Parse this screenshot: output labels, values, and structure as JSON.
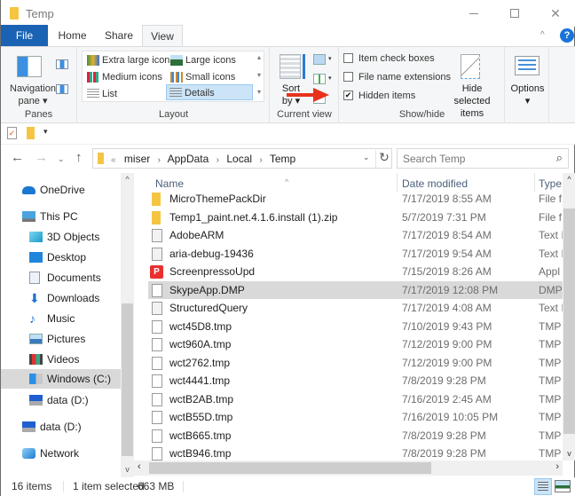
{
  "window": {
    "title": "Temp",
    "controls": {
      "minimize": "—",
      "maximize": "☐",
      "close": "✕"
    }
  },
  "ribbon_tabs": [
    {
      "label": "File",
      "active": false
    },
    {
      "label": "Home",
      "active": false
    },
    {
      "label": "Share",
      "active": false
    },
    {
      "label": "View",
      "active": true
    }
  ],
  "ribbon": {
    "collapse_glyph": "^",
    "help_glyph": "?",
    "panes": {
      "group_label": "Panes",
      "navigation_pane_label": "Navigation pane",
      "dropdown_glyph": "▾"
    },
    "layout": {
      "group_label": "Layout",
      "items": [
        {
          "label": "Extra large icons",
          "selected": false
        },
        {
          "label": "Large icons",
          "selected": false
        },
        {
          "label": "Medium icons",
          "selected": false
        },
        {
          "label": "Small icons",
          "selected": false
        },
        {
          "label": "List",
          "selected": false
        },
        {
          "label": "Details",
          "selected": true
        }
      ],
      "scroll_up": "▴",
      "scroll_down": "▾",
      "more": "▾"
    },
    "current_view": {
      "group_label": "Current view",
      "sort_by_label": "Sort by",
      "dropdown_glyph": "▾"
    },
    "show_hide": {
      "group_label": "Show/hide",
      "checkboxes": [
        {
          "label": "Item check boxes",
          "checked": false
        },
        {
          "label": "File name extensions",
          "checked": false
        },
        {
          "label": "Hidden items",
          "checked": true
        }
      ],
      "hide_selected_label": "Hide selected items"
    },
    "options": {
      "label": "Options",
      "dropdown_glyph": "▾"
    }
  },
  "annotation": {
    "arrow_color": "#e8321c",
    "points_to": "Hidden items"
  },
  "quick_access": {
    "more_glyph": "▾"
  },
  "address_bar": {
    "back": "←",
    "forward": "→",
    "recent": "⌄",
    "up": "↑",
    "overflow": "«",
    "breadcrumbs": [
      "miser",
      "AppData",
      "Local",
      "Temp"
    ],
    "separator": "›",
    "dropdown": "⌄",
    "refresh": "↻"
  },
  "search": {
    "placeholder": "Search Temp",
    "icon": "⌕"
  },
  "nav_pane": {
    "items": [
      {
        "label": "OneDrive",
        "icon": "cloud-icon",
        "level": 0,
        "selected": false
      },
      {
        "label": "This PC",
        "icon": "computer-icon",
        "level": 0,
        "selected": false
      },
      {
        "label": "3D Objects",
        "icon": "cube-icon",
        "level": 1,
        "selected": false
      },
      {
        "label": "Desktop",
        "icon": "desktop-icon",
        "level": 1,
        "selected": false
      },
      {
        "label": "Documents",
        "icon": "document-icon",
        "level": 1,
        "selected": false
      },
      {
        "label": "Downloads",
        "icon": "download-icon",
        "level": 1,
        "selected": false
      },
      {
        "label": "Music",
        "icon": "music-icon",
        "level": 1,
        "selected": false
      },
      {
        "label": "Pictures",
        "icon": "pictures-icon",
        "level": 1,
        "selected": false
      },
      {
        "label": "Videos",
        "icon": "videos-icon",
        "level": 1,
        "selected": false
      },
      {
        "label": "Windows (C:)",
        "icon": "windows-drive-icon",
        "level": 1,
        "selected": true
      },
      {
        "label": "data (D:)",
        "icon": "network-drive-icon",
        "level": 1,
        "selected": false
      },
      {
        "label": "data (D:)",
        "icon": "network-drive-icon",
        "level": 0,
        "selected": false
      },
      {
        "label": "Network",
        "icon": "network-icon",
        "level": 0,
        "selected": false
      }
    ],
    "scroll_up": "^",
    "scroll_down": "v"
  },
  "file_list": {
    "columns": [
      "Name",
      "Date modified",
      "Type"
    ],
    "sort_indicator": "^",
    "rows": [
      {
        "name": "MicroThemePackDir",
        "date": "7/17/2019 8:55 AM",
        "type": "File f",
        "icon": "folder",
        "selected": false
      },
      {
        "name": "Temp1_paint.net.4.1.6.install (1).zip",
        "date": "5/7/2019 7:31 PM",
        "type": "File f",
        "icon": "folder",
        "selected": false
      },
      {
        "name": "AdobeARM",
        "date": "7/17/2019 8:54 AM",
        "type": "Text I",
        "icon": "file",
        "selected": false
      },
      {
        "name": "aria-debug-19436",
        "date": "7/17/2019 9:54 AM",
        "type": "Text I",
        "icon": "file",
        "selected": false
      },
      {
        "name": "ScreenpressoUpd",
        "date": "7/15/2019 8:26 AM",
        "type": "Appl",
        "icon": "app",
        "selected": false
      },
      {
        "name": "SkypeApp.DMP",
        "date": "7/17/2019 12:08 PM",
        "type": "DMP",
        "icon": "file-light",
        "selected": true
      },
      {
        "name": "StructuredQuery",
        "date": "7/17/2019 4:08 AM",
        "type": "Text I",
        "icon": "file",
        "selected": false
      },
      {
        "name": "wct45D8.tmp",
        "date": "7/10/2019 9:43 PM",
        "type": "TMP",
        "icon": "file-light",
        "selected": false
      },
      {
        "name": "wct960A.tmp",
        "date": "7/12/2019 9:00 PM",
        "type": "TMP",
        "icon": "file-light",
        "selected": false
      },
      {
        "name": "wct2762.tmp",
        "date": "7/12/2019 9:00 PM",
        "type": "TMP",
        "icon": "file-light",
        "selected": false
      },
      {
        "name": "wct4441.tmp",
        "date": "7/8/2019 9:28 PM",
        "type": "TMP",
        "icon": "file-light",
        "selected": false
      },
      {
        "name": "wctB2AB.tmp",
        "date": "7/16/2019 2:45 AM",
        "type": "TMP",
        "icon": "file-light",
        "selected": false
      },
      {
        "name": "wctB55D.tmp",
        "date": "7/16/2019 10:05 PM",
        "type": "TMP",
        "icon": "file-light",
        "selected": false
      },
      {
        "name": "wctB665.tmp",
        "date": "7/8/2019 9:28 PM",
        "type": "TMP",
        "icon": "file-light",
        "selected": false
      },
      {
        "name": "wctB946.tmp",
        "date": "7/8/2019 9:28 PM",
        "type": "TMP",
        "icon": "file-light",
        "selected": false
      }
    ],
    "scroll_left": "‹",
    "scroll_right": "›",
    "scroll_up": "^",
    "scroll_down": "v"
  },
  "status_bar": {
    "item_count": "16 items",
    "selection": "1 item selected",
    "size": "663 MB",
    "view_modes": [
      "Details",
      "Large icons"
    ],
    "active_view": "Details"
  },
  "colors": {
    "file_tab": "#1a63b4",
    "selection": "#cce4f7",
    "row_selected": "#d9d9d9",
    "folder": "#f5c542",
    "help": "#1a73d9"
  }
}
